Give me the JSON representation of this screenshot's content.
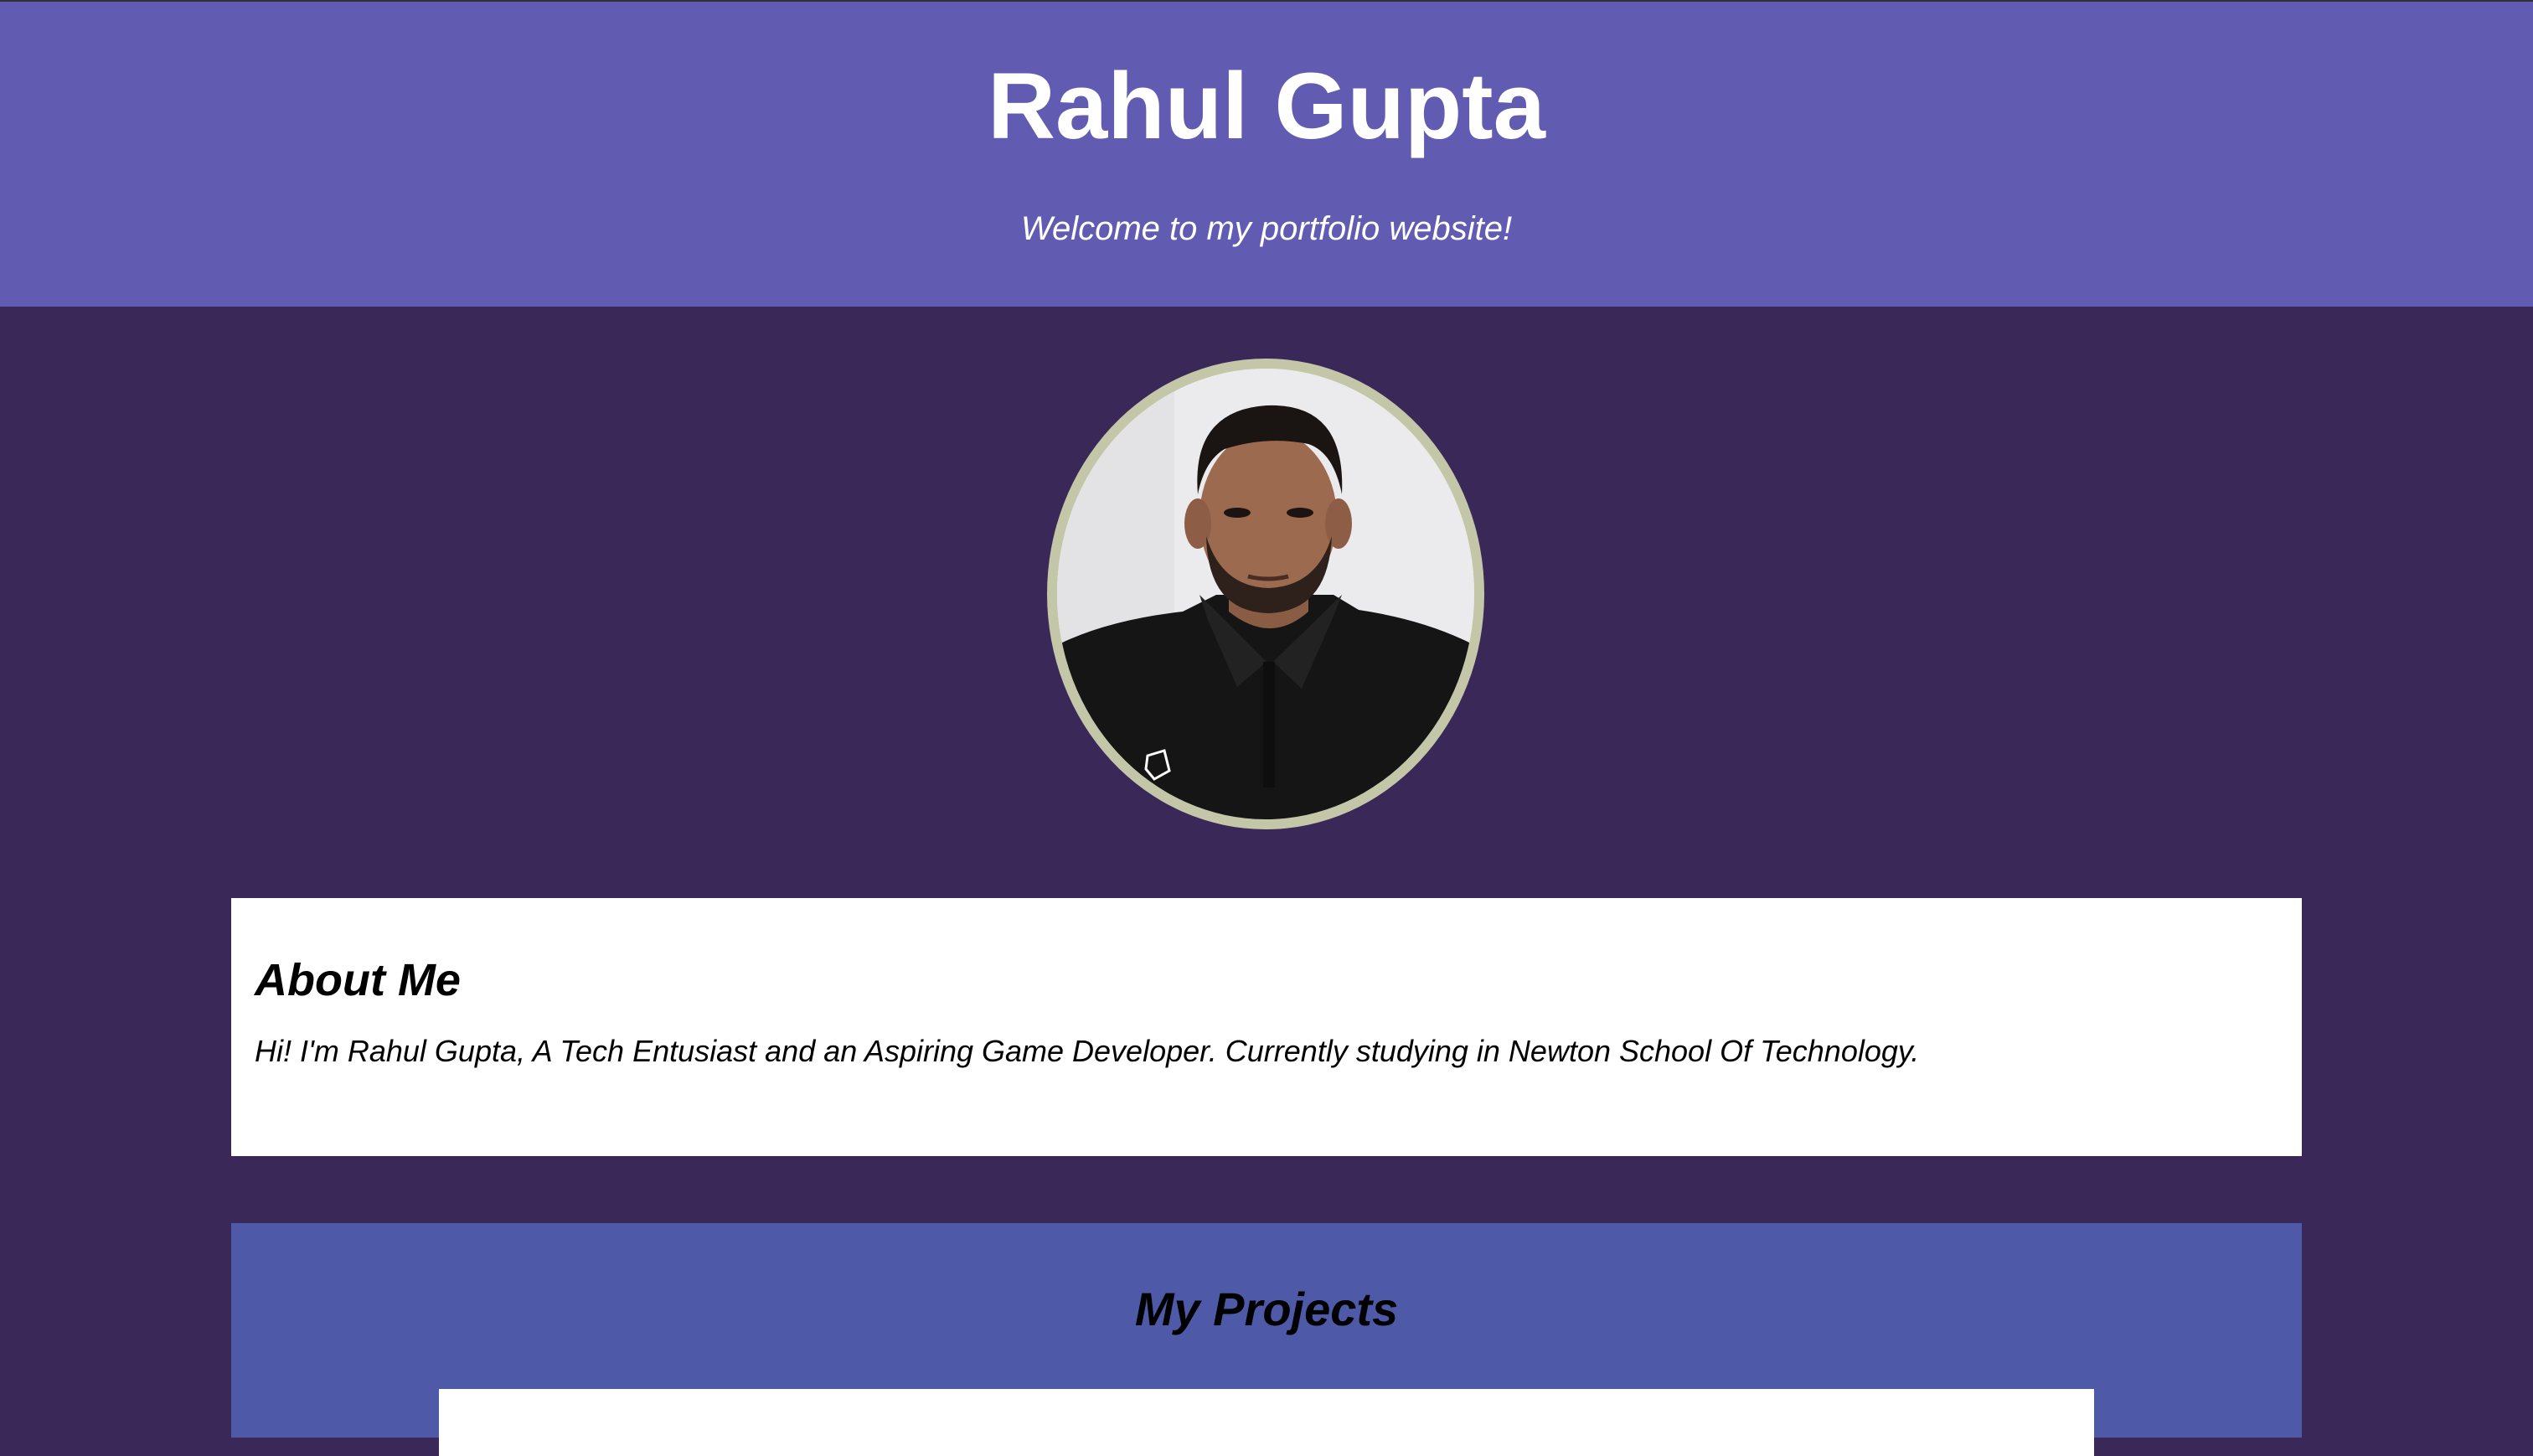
{
  "header": {
    "title": "Rahul Gupta",
    "tagline": "Welcome to my portfolio website!"
  },
  "profile": {
    "image_alt": "Rahul Gupta"
  },
  "about": {
    "heading": "About Me",
    "text": "Hi! I'm Rahul Gupta, A Tech Entusiast and an Aspiring Game Developer. Currently studying in Newton School Of Technology."
  },
  "projects": {
    "heading": "My Projects"
  },
  "colors": {
    "header_bg": "#615cb2",
    "page_bg": "#3a2859",
    "projects_bg": "#4e5aa8",
    "photo_border": "#c4c7a7"
  }
}
